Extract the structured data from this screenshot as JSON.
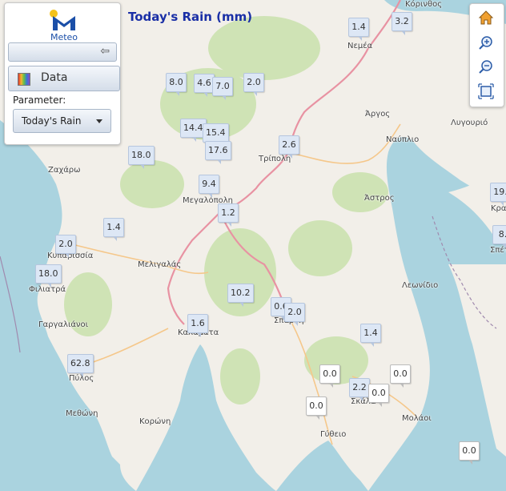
{
  "app": {
    "logo_text": "Meteo"
  },
  "panel": {
    "data_label": "Data",
    "parameter_label": "Parameter:",
    "parameter_value": "Today's Rain"
  },
  "map": {
    "title": "Today's Rain (mm)"
  },
  "stations": [
    {
      "value": "1.4",
      "shade": "blue"
    },
    {
      "value": "3.2",
      "shade": "blue"
    },
    {
      "value": "8.0",
      "shade": "blue"
    },
    {
      "value": "4.6",
      "shade": "blue"
    },
    {
      "value": "7.0",
      "shade": "blue"
    },
    {
      "value": "2.0",
      "shade": "blue"
    },
    {
      "value": "14.4",
      "shade": "blue"
    },
    {
      "value": "15.4",
      "shade": "blue"
    },
    {
      "value": "17.6",
      "shade": "blue"
    },
    {
      "value": "18.0",
      "shade": "blue"
    },
    {
      "value": "2.6",
      "shade": "blue"
    },
    {
      "value": "9.4",
      "shade": "blue"
    },
    {
      "value": "1.2",
      "shade": "blue"
    },
    {
      "value": "19.",
      "shade": "blue"
    },
    {
      "value": "1.4",
      "shade": "blue"
    },
    {
      "value": "8.",
      "shade": "blue"
    },
    {
      "value": "2.0",
      "shade": "blue"
    },
    {
      "value": "18.0",
      "shade": "blue"
    },
    {
      "value": "10.2",
      "shade": "blue"
    },
    {
      "value": "0.6",
      "shade": "blue"
    },
    {
      "value": "2.0",
      "shade": "blue"
    },
    {
      "value": "1.6",
      "shade": "blue"
    },
    {
      "value": "1.4",
      "shade": "blue"
    },
    {
      "value": "62.8",
      "shade": "blue"
    },
    {
      "value": "0.0",
      "shade": "white"
    },
    {
      "value": "0.0",
      "shade": "white"
    },
    {
      "value": "2.2",
      "shade": "blue"
    },
    {
      "value": "0.0",
      "shade": "white"
    },
    {
      "value": "0.0",
      "shade": "white"
    },
    {
      "value": "0.0",
      "shade": "white"
    }
  ],
  "places": [
    "Κόρινθος",
    "Νεμέα",
    "Άργος",
    "Ναύπλιο",
    "Λυγουριό",
    "Τρίπολη",
    "Άστρος",
    "Ζαχάρω",
    "Μεγαλόπολη",
    "Κυπαρισσία",
    "Μελιγαλάς",
    "Φιλιατρά",
    "Γαργαλιάνοι",
    "Καλαμάτα",
    "Σπάρτη",
    "Λεωνίδιο",
    "Πύλος",
    "Μεθώνη",
    "Κορώνη",
    "Σκάλα",
    "Μολάοι",
    "Γύθειο",
    "Κρα",
    "Σπέτ"
  ],
  "colors": {
    "land": "#f2efe9",
    "forest": "#cfe3b5",
    "water": "#aad3df",
    "primary_road": "#e892a2",
    "secondary_road": "#f5c78a",
    "title": "#1a2fa6",
    "marker_bg": "#dde7f5"
  },
  "icons": [
    "home-icon",
    "zoom-in-icon",
    "zoom-out-icon",
    "zoom-extent-icon",
    "collapse-arrow-icon",
    "palette-icon",
    "dropdown-caret-icon"
  ]
}
